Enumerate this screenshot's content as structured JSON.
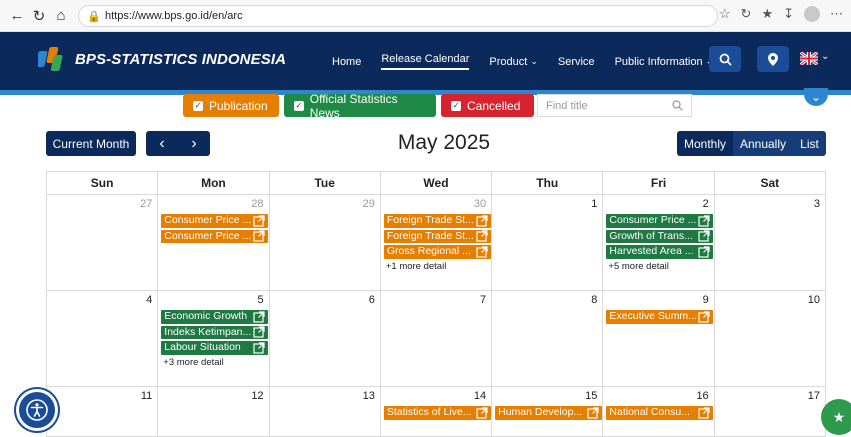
{
  "browser": {
    "url": "https://www.bps.go.id/en/arc"
  },
  "header": {
    "brand": "BPS-STATISTICS INDONESIA",
    "nav": [
      {
        "label": "Home"
      },
      {
        "label": "Release Calendar"
      },
      {
        "label": "Product"
      },
      {
        "label": "Service"
      },
      {
        "label": "Public Information"
      }
    ],
    "colors": {
      "navbar": "#0b2a5b",
      "accent": "#2e86d1"
    }
  },
  "filters": {
    "publication": "Publication",
    "news": "Official Statistics News",
    "cancelled": "Cancelled",
    "find_placeholder": "Find title",
    "colors": {
      "publication": "#e67e00",
      "news": "#1e8a45",
      "cancelled": "#d7232f"
    }
  },
  "toolbar": {
    "current_month": "Current Month",
    "prev": "‹",
    "next": "›",
    "title": "May 2025",
    "views": [
      "Monthly",
      "Annually",
      "List"
    ]
  },
  "calendar": {
    "weekdays": [
      "Sun",
      "Mon",
      "Tue",
      "Wed",
      "Thu",
      "Fri",
      "Sat"
    ],
    "weeks": [
      {
        "days": [
          {
            "num": "27",
            "dim": true,
            "events": [],
            "more": ""
          },
          {
            "num": "28",
            "dim": true,
            "events": [
              {
                "title": "Consumer Price ...",
                "color": "orange"
              },
              {
                "title": "Consumer Price ...",
                "color": "orange"
              }
            ],
            "more": ""
          },
          {
            "num": "29",
            "dim": true,
            "events": [],
            "more": ""
          },
          {
            "num": "30",
            "dim": true,
            "events": [
              {
                "title": "Foreign Trade St...",
                "color": "orange"
              },
              {
                "title": "Foreign Trade St...",
                "color": "orange"
              },
              {
                "title": "Gross Regional ...",
                "color": "orange"
              }
            ],
            "more": "+1 more detail"
          },
          {
            "num": "1",
            "dim": false,
            "events": [],
            "more": ""
          },
          {
            "num": "2",
            "dim": false,
            "events": [
              {
                "title": "Consumer Price ...",
                "color": "green"
              },
              {
                "title": "Growth of Trans...",
                "color": "green"
              },
              {
                "title": "Harvested Area ...",
                "color": "green"
              }
            ],
            "more": "+5 more detail"
          },
          {
            "num": "3",
            "dim": false,
            "events": [],
            "more": ""
          }
        ]
      },
      {
        "days": [
          {
            "num": "4",
            "dim": false,
            "events": [],
            "more": ""
          },
          {
            "num": "5",
            "dim": false,
            "events": [
              {
                "title": "Economic Growth",
                "color": "green"
              },
              {
                "title": "Indeks Ketimpan...",
                "color": "green"
              },
              {
                "title": "Labour Situation",
                "color": "green"
              }
            ],
            "more": "+3 more detail"
          },
          {
            "num": "6",
            "dim": false,
            "events": [],
            "more": ""
          },
          {
            "num": "7",
            "dim": false,
            "events": [],
            "more": ""
          },
          {
            "num": "8",
            "dim": false,
            "events": [],
            "more": ""
          },
          {
            "num": "9",
            "dim": false,
            "events": [
              {
                "title": "Executive Summ...",
                "color": "orange"
              }
            ],
            "more": ""
          },
          {
            "num": "10",
            "dim": false,
            "events": [],
            "more": ""
          }
        ]
      },
      {
        "days": [
          {
            "num": "11",
            "dim": false,
            "events": [],
            "more": ""
          },
          {
            "num": "12",
            "dim": false,
            "events": [],
            "more": ""
          },
          {
            "num": "13",
            "dim": false,
            "events": [],
            "more": ""
          },
          {
            "num": "14",
            "dim": false,
            "events": [
              {
                "title": "Statistics of Live...",
                "color": "orange"
              }
            ],
            "more": ""
          },
          {
            "num": "15",
            "dim": false,
            "events": [
              {
                "title": "Human Develop...",
                "color": "orange"
              }
            ],
            "more": ""
          },
          {
            "num": "16",
            "dim": false,
            "events": [
              {
                "title": "National Consu...",
                "color": "orange"
              }
            ],
            "more": ""
          },
          {
            "num": "17",
            "dim": false,
            "events": [],
            "more": ""
          }
        ]
      }
    ]
  }
}
